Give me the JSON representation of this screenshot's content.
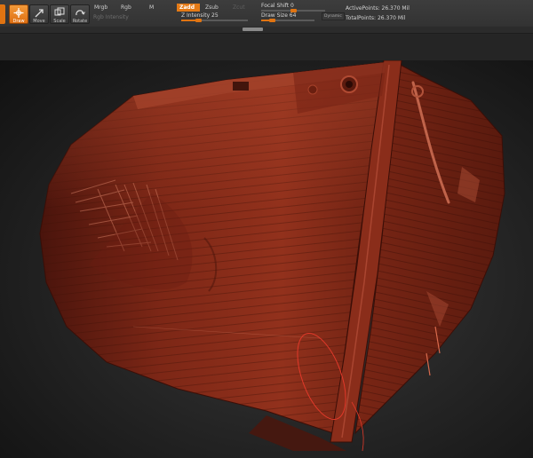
{
  "toolbar": {
    "tools": [
      {
        "label": "Draw",
        "icon": "draw-icon",
        "active": true
      },
      {
        "label": "Move",
        "icon": "move-icon",
        "active": false
      },
      {
        "label": "Scale",
        "icon": "scale-icon",
        "active": false
      },
      {
        "label": "Rotate",
        "icon": "rotate-icon",
        "active": false
      }
    ],
    "mrgb": "Mrgb",
    "rgb": "Rgb",
    "m": "M",
    "rgb_intensity": "Rgb Intensity",
    "zadd": "Zadd",
    "zsub": "Zsub",
    "zcut": "Zcut",
    "z_intensity": {
      "label": "Z Intensity 25",
      "value": 25,
      "max": 100
    },
    "focal_shift": {
      "label": "Focal Shift 0",
      "value": 0
    },
    "draw_size": {
      "label": "Draw Size 64",
      "value": 64,
      "max": 1000
    },
    "dynamic": "Dynamic",
    "active_points": "ActivePoints: 26.370 Mil",
    "total_points": "TotalPoints: 26.370 Mil"
  },
  "colors": {
    "accent": "#E07412",
    "mesh": "#8E2F1C",
    "background": "#232323"
  }
}
